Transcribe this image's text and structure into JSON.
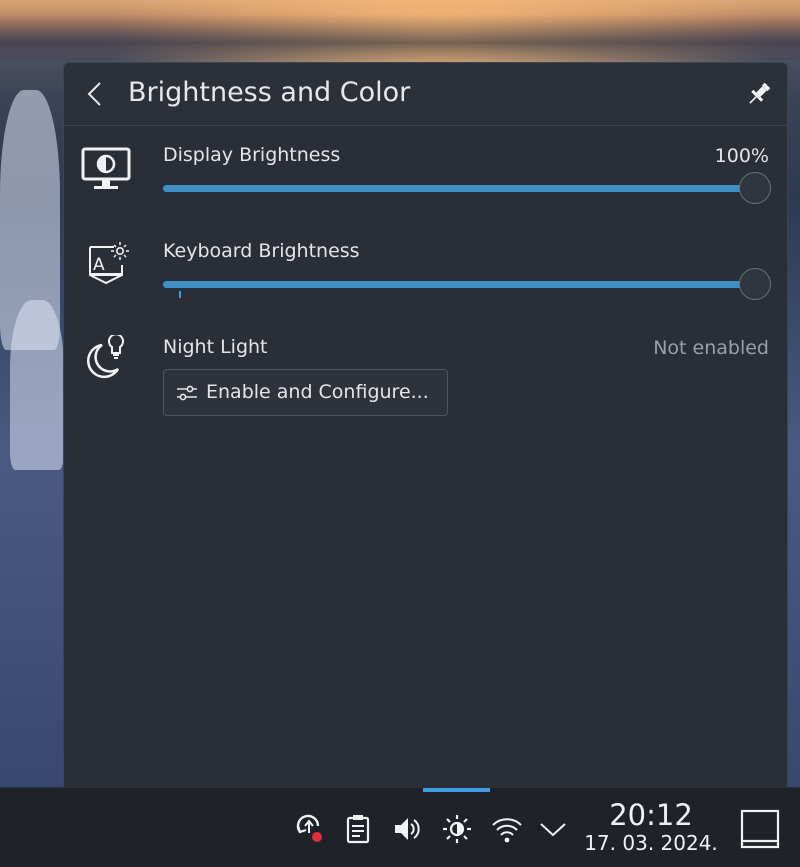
{
  "popup": {
    "title": "Brightness and Color",
    "back_icon": "chevron-left-icon",
    "pin_icon": "pin-icon"
  },
  "display_brightness": {
    "label": "Display Brightness",
    "value_text": "100%",
    "level": 1.0,
    "icon": "monitor-brightness-icon"
  },
  "keyboard_brightness": {
    "label": "Keyboard Brightness",
    "level": 1.0,
    "icon": "keyboard-brightness-icon"
  },
  "night_light": {
    "label": "Night Light",
    "status": "Not enabled",
    "button_label": "Enable and Configure...",
    "icon": "night-light-icon",
    "button_icon": "configure-sliders-icon"
  },
  "taskbar": {
    "tray_icons": [
      "update-notifier-icon",
      "clipboard-icon",
      "volume-icon",
      "brightness-icon",
      "wifi-icon",
      "expand-tray-icon"
    ],
    "time": "20:12",
    "date": "17. 03. 2024.",
    "show_desktop_icon": "show-desktop-icon"
  },
  "colors": {
    "accent": "#3d9ee6",
    "panel_bg": "#2a2e37",
    "taskbar_bg": "#1f2329",
    "muted_text": "#9aa0a8",
    "notification_dot": "#e0313a"
  }
}
